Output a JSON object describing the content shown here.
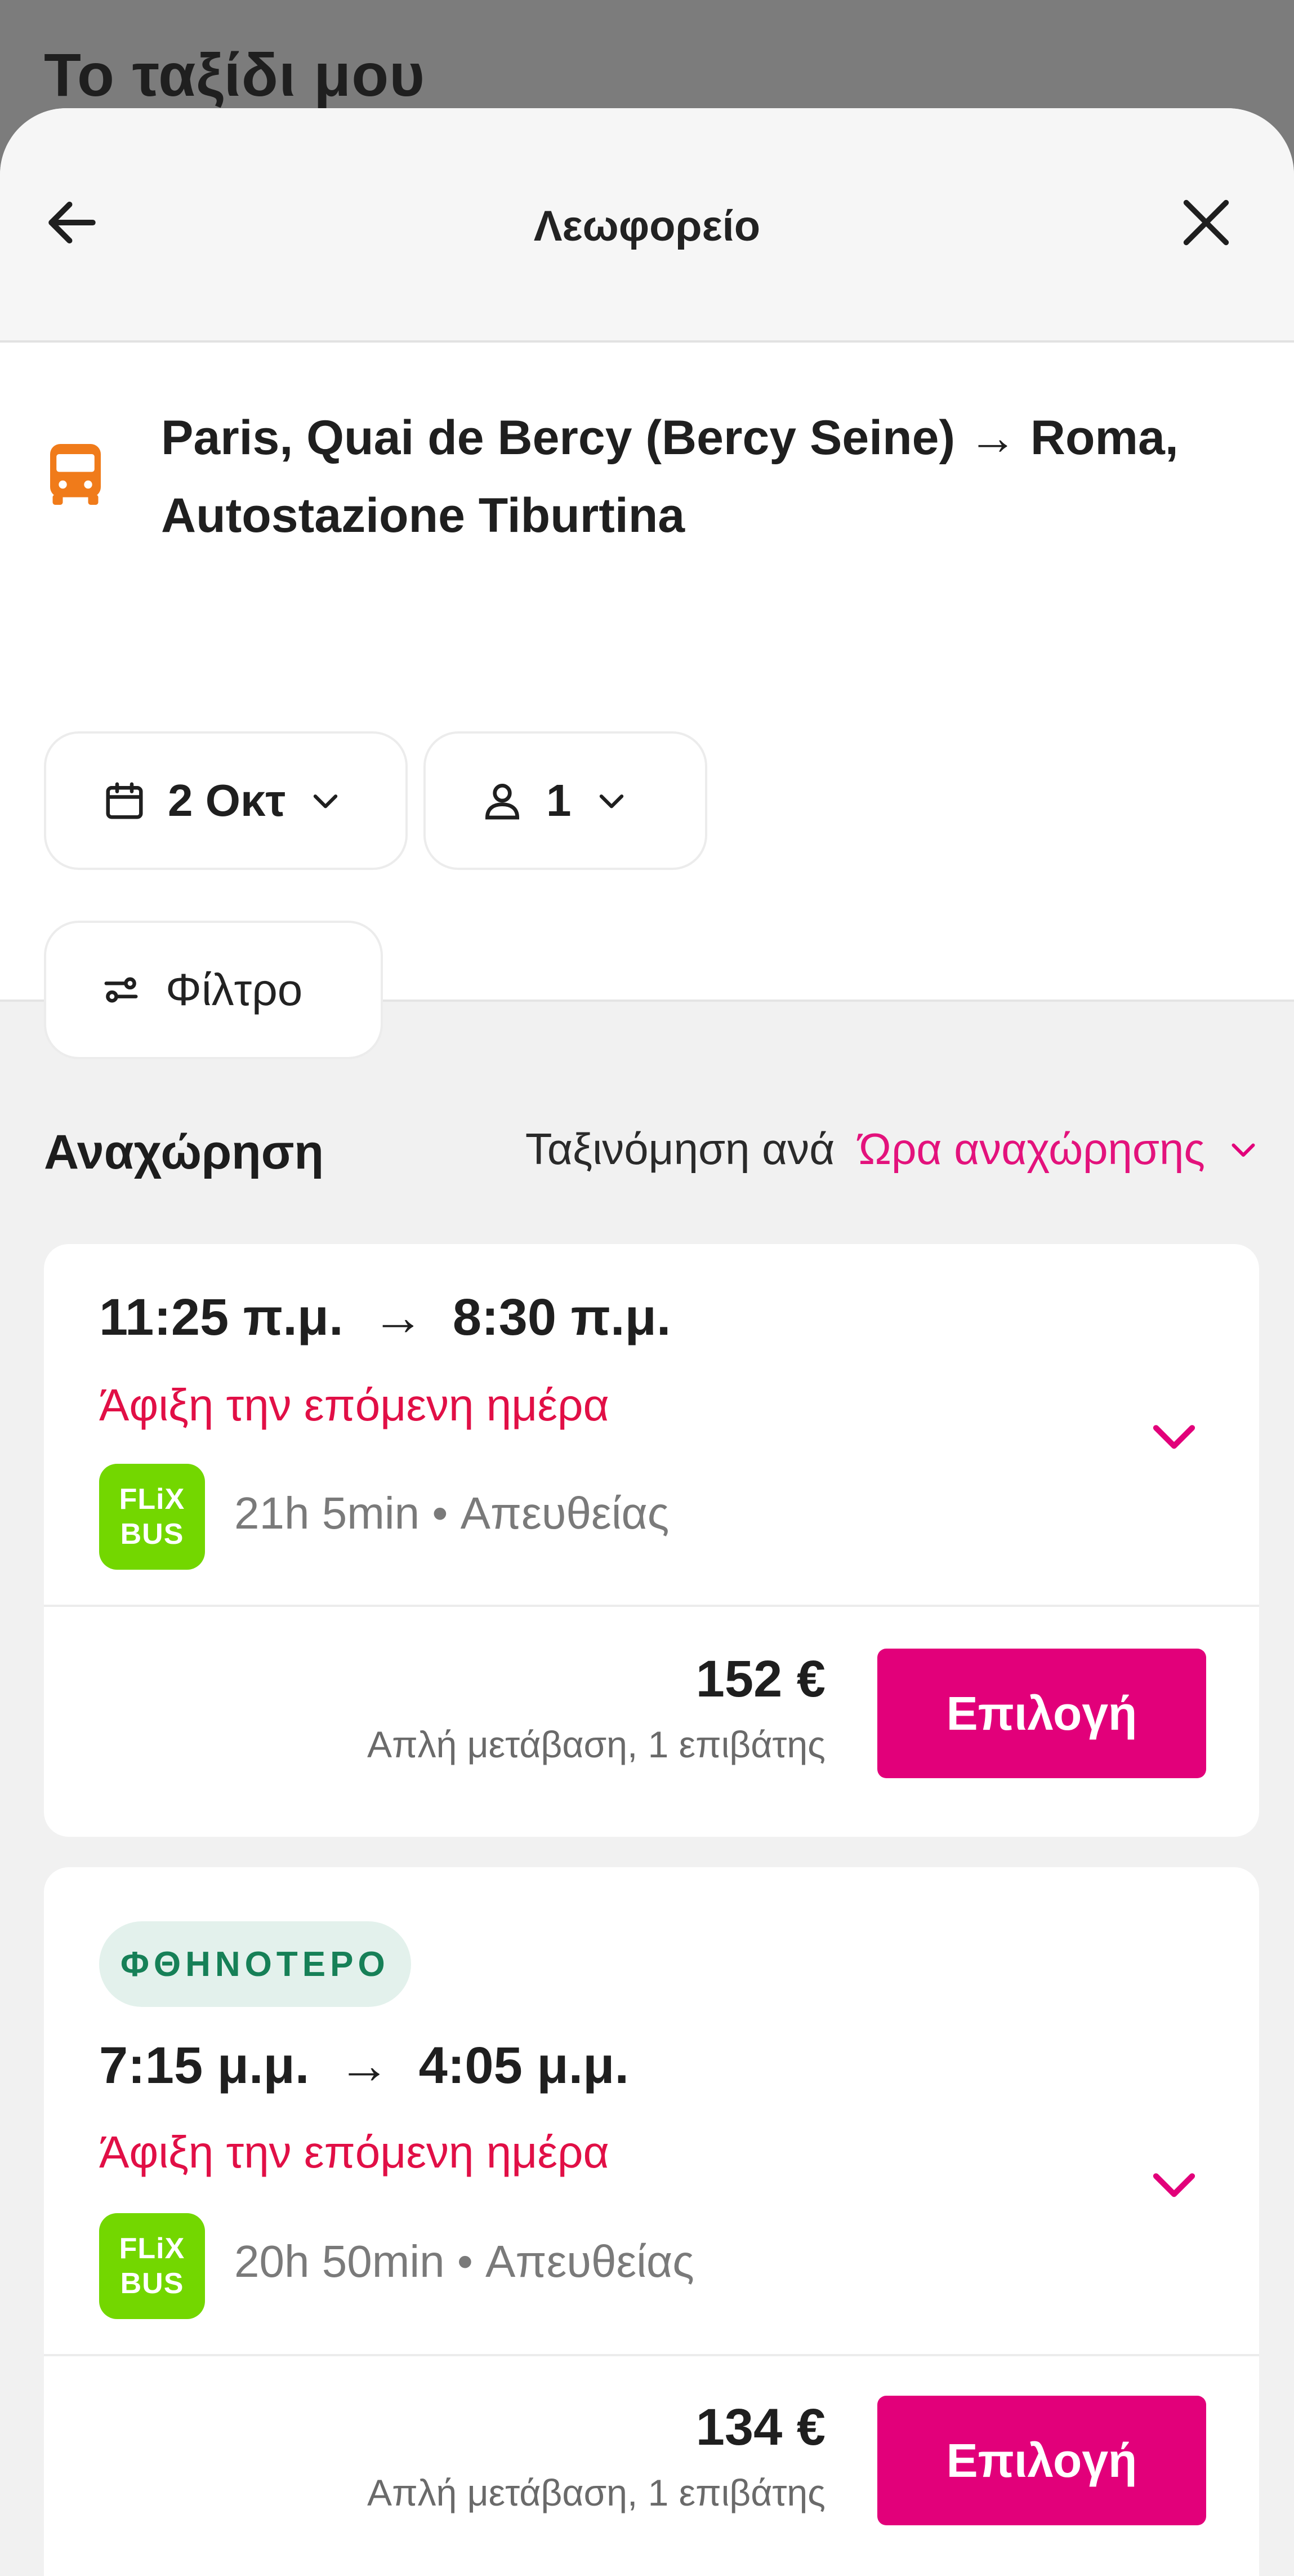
{
  "backdrop": {
    "title": "Το ταξίδι μου"
  },
  "header": {
    "title": "Λεωφορείο",
    "back_icon": "arrow-left-icon",
    "close_icon": "close-icon"
  },
  "search": {
    "route": "Paris, Quai de Bercy (Bercy Seine) → Roma, Autostazione Tiburtina",
    "route_icon": "bus-icon",
    "date_label": "2 Οκτ",
    "passengers_label": "1",
    "filter_label": "Φίλτρο"
  },
  "results": {
    "heading": "Αναχώρηση",
    "sort_prefix": "Ταξινόμηση ανά",
    "sort_value": "Ώρα αναχώρησης"
  },
  "trips": [
    {
      "badge": "",
      "depart": "11:25 π.μ.",
      "arrive": "8:30 π.μ.",
      "times": "11:25 π.μ.  →  8:30 π.μ.",
      "arrival_note": "Άφιξη την επόμενη ημέρα",
      "operator_logo": [
        "FLiX",
        "BUS"
      ],
      "meta": "21h 5min • Απευθείας",
      "price": "152 €",
      "price_note": "Απλή μετάβαση, 1 επιβάτης",
      "select_label": "Επιλογή"
    },
    {
      "badge": "ΦΘΗΝΟΤΕΡΟ",
      "depart": "7:15 μ.μ.",
      "arrive": "4:05 μ.μ.",
      "times": "7:15 μ.μ.  →  4:05 μ.μ.",
      "arrival_note": "Άφιξη την επόμενη ημέρα",
      "operator_logo": [
        "FLiX",
        "BUS"
      ],
      "meta": "20h 50min • Απευθείας",
      "price": "134 €",
      "price_note": "Απλή μετάβαση, 1 επιβάτης",
      "select_label": "Επιλογή"
    }
  ],
  "colors": {
    "accent": "#e2007a",
    "arrival": "#e10f46",
    "bus_icon": "#f07b1a",
    "flixbus": "#73d700",
    "badge_bg": "#e3f1ec",
    "badge_text": "#168057"
  }
}
